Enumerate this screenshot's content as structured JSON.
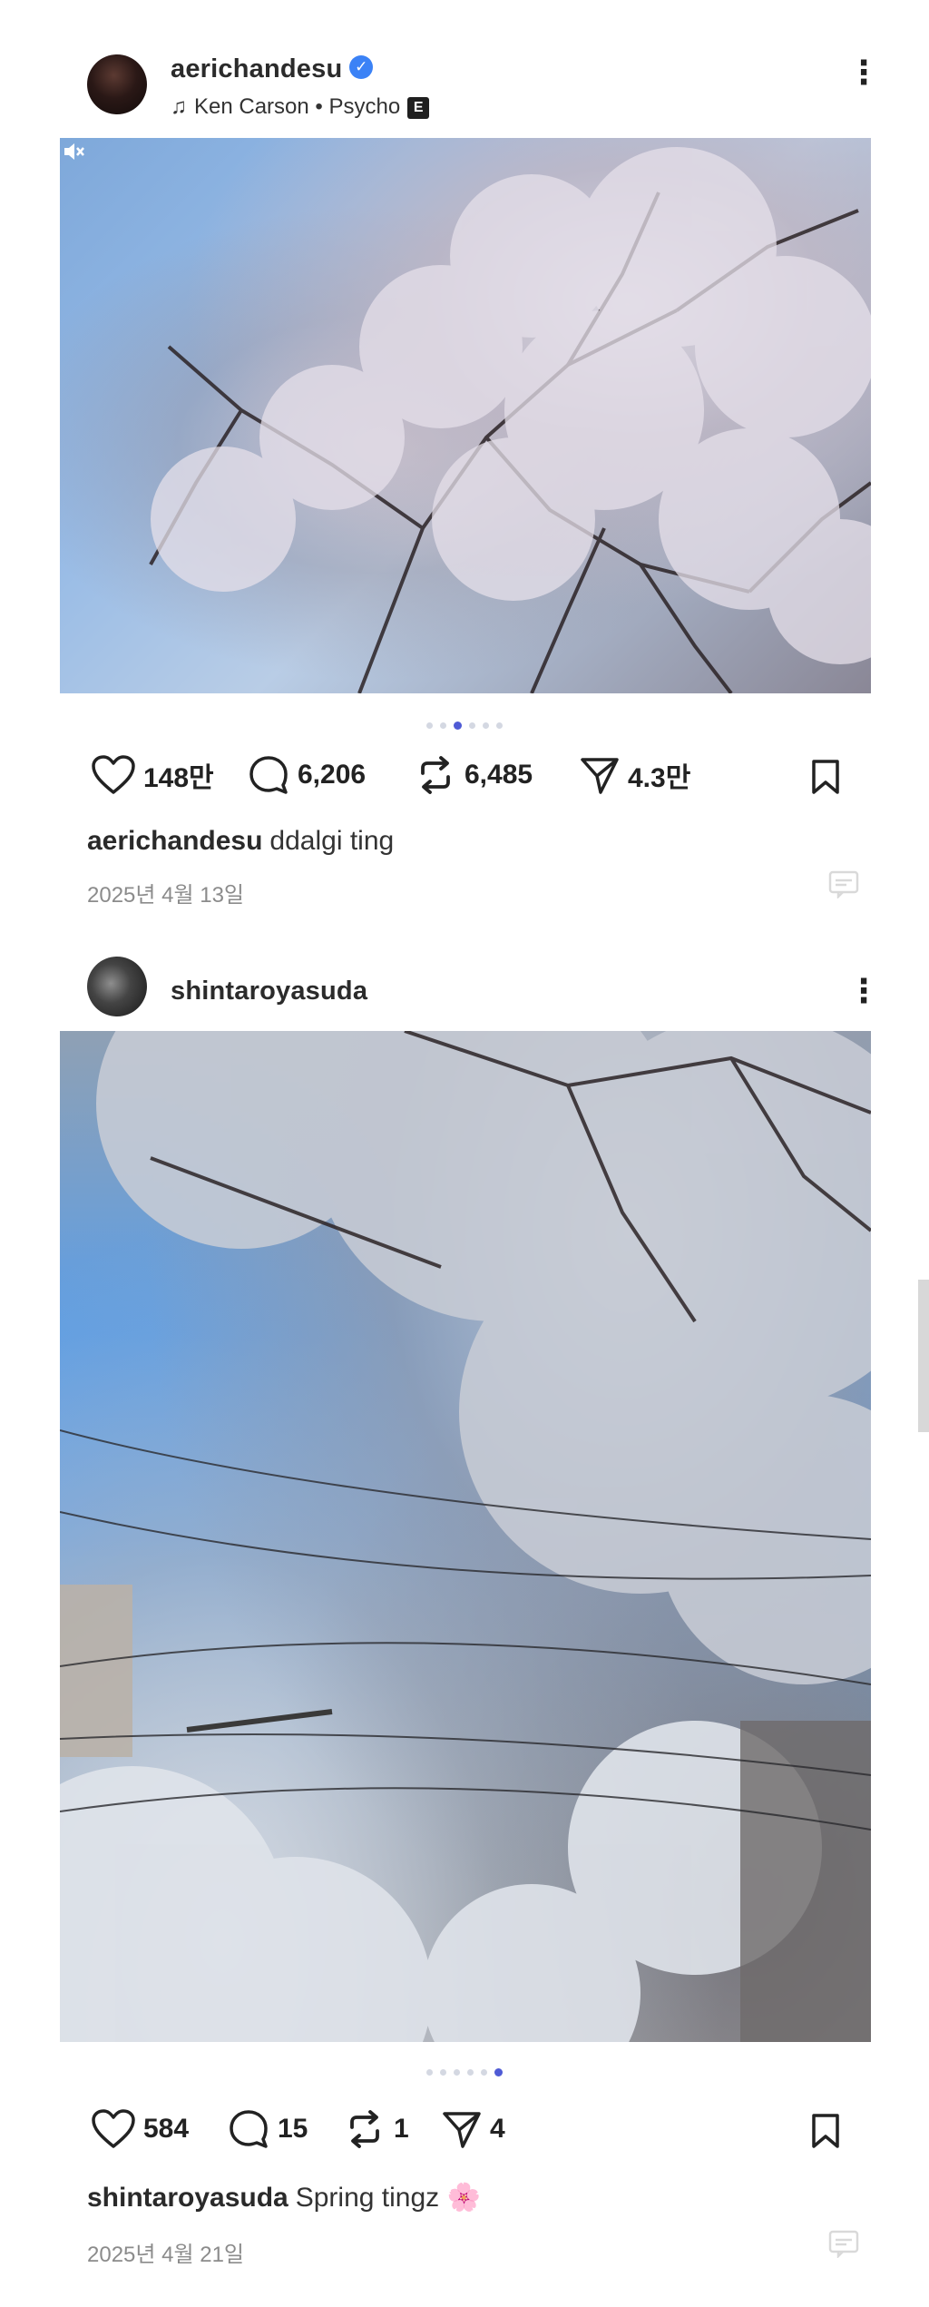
{
  "posts": [
    {
      "user": {
        "username": "aerichandesu",
        "verified": true
      },
      "music": {
        "artist_track": "Ken Carson • Psycho",
        "explicit_badge": "E"
      },
      "media": {
        "description": "cherry blossom tree branches against blue sky",
        "slide_count": 6,
        "active_slide": 3,
        "has_mute_icon": true
      },
      "actions": {
        "likes": "148만",
        "comments": "6,206",
        "reposts": "6,485",
        "shares": "4.3만"
      },
      "caption": {
        "username": "aerichandesu",
        "text": "ddalgi ting"
      },
      "date": "2025년 4월 13일"
    },
    {
      "user": {
        "username": "shintaroyasuda",
        "verified": false
      },
      "media": {
        "description": "cherry blossom trees over street with power lines and blue sky",
        "slide_count": 6,
        "active_slide": 6
      },
      "actions": {
        "likes": "584",
        "comments": "15",
        "reposts": "1",
        "shares": "4"
      },
      "caption": {
        "username": "shintaroyasuda",
        "text": "Spring tingz 🌸"
      },
      "date": "2025년 4월 21일"
    }
  ],
  "colors": {
    "dot_active": "#4f5bd5",
    "verified": "#3b82f6",
    "text": "#222222",
    "muted": "#8b8b8b"
  }
}
